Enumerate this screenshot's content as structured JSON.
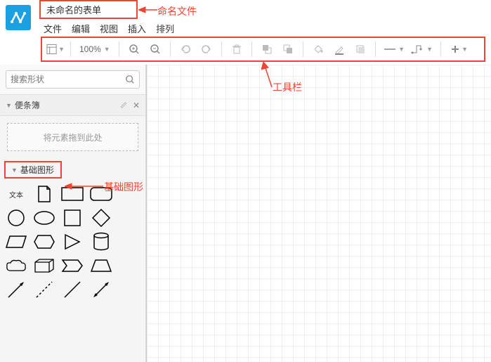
{
  "header": {
    "doc_title": "未命名的表单",
    "menus": [
      "文件",
      "编辑",
      "视图",
      "插入",
      "排列"
    ]
  },
  "toolbar": {
    "zoom": "100%"
  },
  "sidebar": {
    "search_placeholder": "搜索形状",
    "scratchpad_label": "便条簿",
    "dropzone_text": "将元素拖到此处",
    "basic_shapes_label": "基础图形",
    "text_shape_label": "文本"
  },
  "annotations": {
    "rename_file": "命名文件",
    "toolbar": "工具栏",
    "basic_shapes": "基础图形"
  }
}
